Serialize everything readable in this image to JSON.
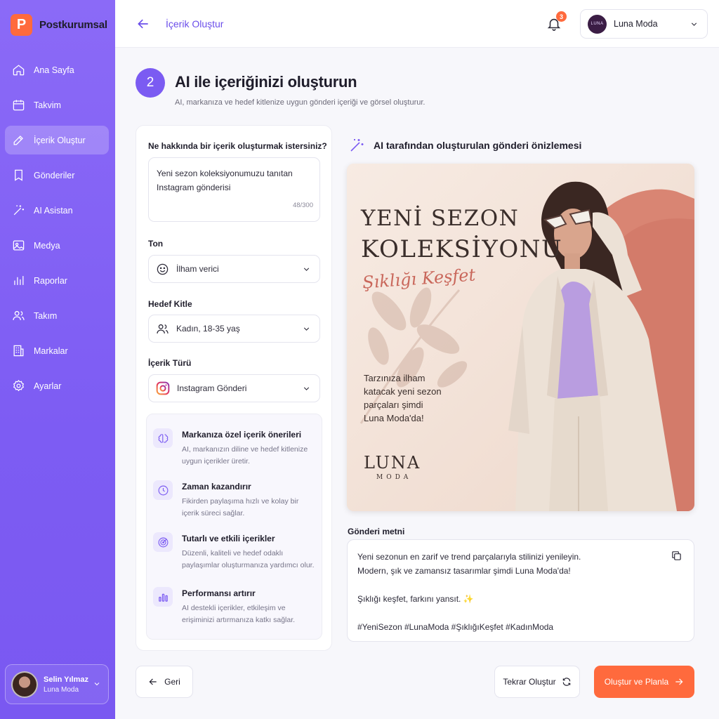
{
  "app": {
    "name": "Postkurumsal",
    "logo_letter": "P"
  },
  "sidebar": {
    "items": [
      {
        "label": "Ana Sayfa",
        "icon": "home-icon"
      },
      {
        "label": "Takvim",
        "icon": "calendar-icon"
      },
      {
        "label": "İçerik Oluştur",
        "icon": "pencil-icon",
        "active": true
      },
      {
        "label": "Gönderiler",
        "icon": "bookmark-icon"
      },
      {
        "label": "AI Asistan",
        "icon": "magic-wand-icon"
      },
      {
        "label": "Medya",
        "icon": "image-icon"
      },
      {
        "label": "Raporlar",
        "icon": "bar-chart-icon"
      },
      {
        "label": "Takım",
        "icon": "users-icon"
      },
      {
        "label": "Markalar",
        "icon": "building-icon"
      },
      {
        "label": "Ayarlar",
        "icon": "gear-icon"
      }
    ],
    "user": {
      "name": "Selin Yılmaz",
      "brand": "Luna Moda"
    }
  },
  "topbar": {
    "title": "İçerik Oluştur",
    "notification_count": "3",
    "brand_select": {
      "label": "Luna Moda",
      "logo_text": "LUNA"
    }
  },
  "header": {
    "step": "2",
    "title": "AI ile içeriğinizi oluşturun",
    "subtitle": "AI, markanıza ve hedef kitlenize uygun gönderi içeriği ve görsel oluşturur."
  },
  "form": {
    "topic_label": "Ne hakkında bir içerik oluşturmak istersiniz?",
    "topic_value_line1": "Yeni sezon koleksiyonumuzu tanıtan",
    "topic_value_line2": "Instagram gönderisi",
    "char_count": "48/300",
    "tone_label": "Ton",
    "tone_value": "İlham verici",
    "audience_label": "Hedef Kitle",
    "audience_value": "Kadın, 18-35 yaş",
    "type_label": "İçerik Türü",
    "type_value": "Instagram Gönderi"
  },
  "features": [
    {
      "title": "Markanıza özel içerik önerileri",
      "desc": "AI, markanızın diline ve hedef kitlenize uygun içerikler üretir.",
      "icon": "brain-icon"
    },
    {
      "title": "Zaman kazandırır",
      "desc": "Fikirden paylaşıma hızlı ve kolay bir içerik süreci sağlar.",
      "icon": "clock-icon"
    },
    {
      "title": "Tutarlı ve etkili içerikler",
      "desc": "Düzenli, kaliteli ve hedef odaklı paylaşımlar oluşturmanıza yardımcı olur.",
      "icon": "target-icon"
    },
    {
      "title": "Performansı artırır",
      "desc": "AI destekli içerikler, etkileşim ve erişiminizi artırmanıza katkı sağlar.",
      "icon": "bar-chart-icon"
    }
  ],
  "preview": {
    "heading": "AI tarafından oluşturulan gönderi önizlemesi",
    "image": {
      "headline_line1": "YENİ SEZON",
      "headline_line2": "KOLEKSİYONU",
      "script_text": "Şıklığı Keşfet",
      "body_line1": "Tarzınıza ilham",
      "body_line2": "katacak yeni sezon",
      "body_line3": "parçaları şimdi",
      "body_line4": "Luna Moda'da!",
      "logo": "LUNA",
      "logo_sub": "MODA"
    },
    "caption_label": "Gönderi metni",
    "caption_lines": [
      "Yeni sezonun en zarif ve trend parçalarıyla stilinizi yenileyin.",
      "Modern, şık ve zamansız tasarımlar şimdi Luna Moda'da!",
      "",
      "Şıklığı keşfet, farkını yansıt. ✨",
      "",
      "#YeniSezon #LunaModa #ŞıklığıKeşfet #KadınModa"
    ]
  },
  "buttons": {
    "back": "Geri",
    "retry": "Tekrar Oluştur",
    "primary": "Oluştur ve Planla"
  },
  "colors": {
    "sidebar": "#8b6af7",
    "accent": "#7b5bf2",
    "primary_button": "#ff6a3d"
  }
}
